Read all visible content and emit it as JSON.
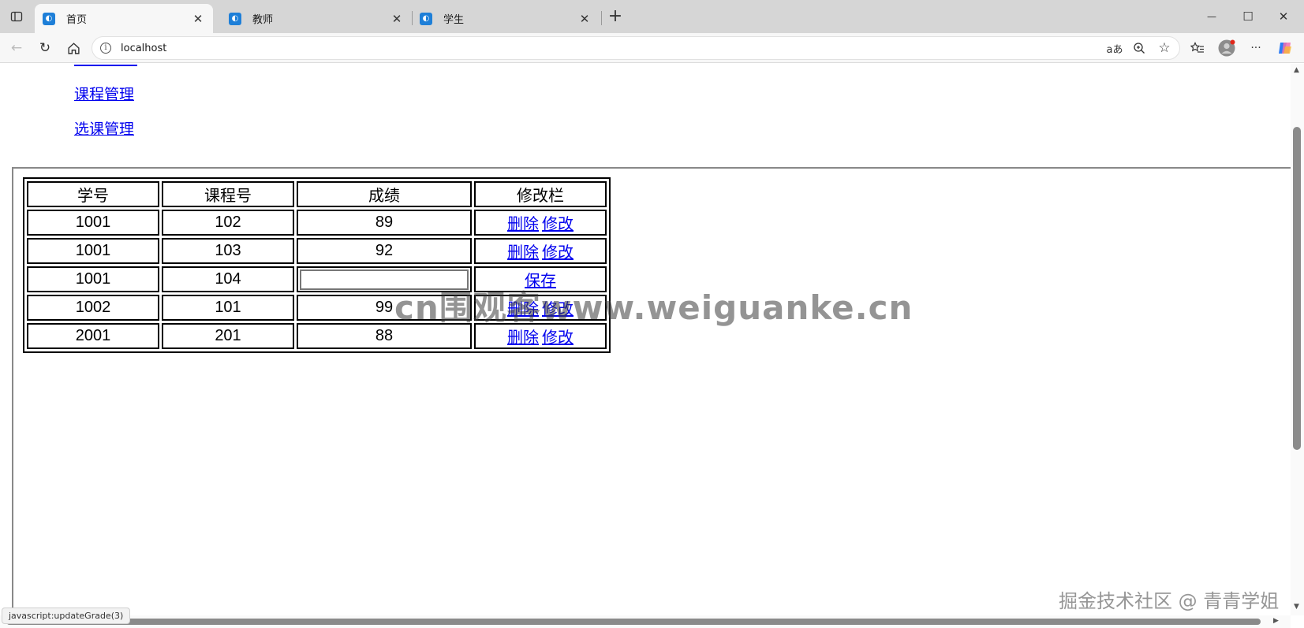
{
  "browser": {
    "tabs": [
      {
        "label": "首页",
        "active": true
      },
      {
        "label": "教师",
        "active": false
      },
      {
        "label": "学生",
        "active": false
      }
    ],
    "new_tab_label": "+",
    "address": "localhost",
    "window_controls": {
      "minimize": "—",
      "maximize": "☐",
      "close": "✕"
    },
    "toolbar_icons": [
      "back-icon",
      "reload-icon",
      "home-icon",
      "read-aloud-icon",
      "zoom-icon",
      "favorite-icon",
      "favorites-icon",
      "profile-icon",
      "more-icon",
      "copilot-icon"
    ],
    "read_aloud_text": "aあ",
    "more_text": "···"
  },
  "nav": {
    "links": [
      "课程管理",
      "选课管理"
    ]
  },
  "grades_table": {
    "headers": [
      "学号",
      "课程号",
      "成绩",
      "修改栏"
    ],
    "rows": [
      {
        "student_id": "1001",
        "course_id": "102",
        "grade": "89",
        "actions": [
          "删除",
          "修改"
        ]
      },
      {
        "student_id": "1001",
        "course_id": "103",
        "grade": "92",
        "actions": [
          "删除",
          "修改"
        ]
      },
      {
        "student_id": "1001",
        "course_id": "104",
        "grade": "",
        "editing": true,
        "actions": [
          "保存"
        ]
      },
      {
        "student_id": "1002",
        "course_id": "101",
        "grade": "99",
        "actions": [
          "删除",
          "修改"
        ]
      },
      {
        "student_id": "2001",
        "course_id": "201",
        "grade": "88",
        "actions": [
          "删除",
          "修改"
        ]
      }
    ]
  },
  "status_bar": "javascript:updateGrade(3)",
  "watermarks": {
    "center": "cn围观客www.weiguanke.cn",
    "corner": "掘金技术社区 @ 青青学姐"
  }
}
